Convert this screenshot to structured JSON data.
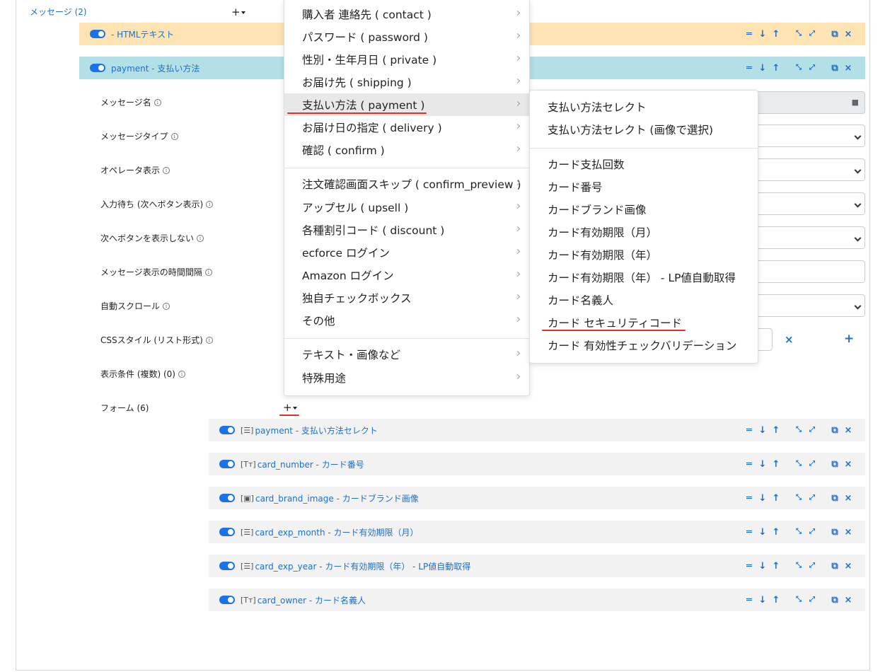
{
  "message_section": {
    "label": "メッセージ (2)",
    "add_button": "+"
  },
  "messages": [
    {
      "label": "- HTMLテキスト",
      "color": "#fde4b2"
    },
    {
      "label": "payment - 支払い方法",
      "color": "#b3e0e6"
    }
  ],
  "settings": [
    {
      "label": "メッセージ名"
    },
    {
      "label": "メッセージタイプ"
    },
    {
      "label": "オペレータ表示"
    },
    {
      "label": "入力待ち (次へボタン表示)"
    },
    {
      "label": "次へボタンを表示しない"
    },
    {
      "label": "メッセージ表示の時間間隔"
    },
    {
      "label": "自動スクロール"
    },
    {
      "label": "CSSスタイル (リスト形式)"
    }
  ],
  "conditions_link": "表示条件 (複数) (0)",
  "forms_section": {
    "label": "フォーム (6)",
    "add_button": "+"
  },
  "forms": [
    {
      "type": "[☰]",
      "label": "payment - 支払い方法セレクト"
    },
    {
      "type": "[Tт]",
      "label": "card_number - カード番号"
    },
    {
      "type": "[▣]",
      "label": "card_brand_image - カードブランド画像"
    },
    {
      "type": "[☰]",
      "label": "card_exp_month - カード有効期限（月）"
    },
    {
      "type": "[☰]",
      "label": "card_exp_year - カード有効期限（年） - LP値自動取得"
    },
    {
      "type": "[Tт]",
      "label": "card_owner - カード名義人"
    }
  ],
  "row_actions": {
    "drag": "═",
    "down": "↓",
    "up": "↑",
    "collapse": "⤡",
    "expand": "⤢",
    "copy": "⧉",
    "delete": "×"
  },
  "css_field_actions": {
    "remove": "×",
    "add": "+"
  },
  "menu": {
    "items": [
      {
        "label": "購入者 連絡先 ( contact )"
      },
      {
        "label": "パスワード ( password )"
      },
      {
        "label": "性別・生年月日 ( private )"
      },
      {
        "label": "お届け先 ( shipping )"
      },
      {
        "label": "支払い方法 ( payment )"
      },
      {
        "label": "お届け日の指定 ( delivery )"
      },
      {
        "label": "確認 ( confirm )"
      },
      {
        "label": "注文確認画面スキップ ( confirm_preview )"
      },
      {
        "label": "アップセル ( upsell )"
      },
      {
        "label": "各種割引コード ( discount )"
      },
      {
        "label": "ecforce ログイン"
      },
      {
        "label": "Amazon ログイン"
      },
      {
        "label": "独自チェックボックス"
      },
      {
        "label": "その他"
      },
      {
        "label": "テキスト・画像など"
      },
      {
        "label": "特殊用途"
      }
    ]
  },
  "submenu": {
    "items": [
      {
        "label": "支払い方法セレクト"
      },
      {
        "label": "支払い方法セレクト (画像で選択)"
      },
      {
        "label": "カード支払回数"
      },
      {
        "label": "カード番号"
      },
      {
        "label": "カードブランド画像"
      },
      {
        "label": "カード有効期限（月）"
      },
      {
        "label": "カード有効期限（年）"
      },
      {
        "label": "カード有効期限（年） - LP値自動取得"
      },
      {
        "label": "カード名義人"
      },
      {
        "label": "カード セキュリティコード"
      },
      {
        "label": "カード 有効性チェックバリデーション"
      }
    ]
  },
  "colors": {
    "link": "#1f6fc5",
    "toggle": "#1a73e8",
    "highlight": "#e0302a"
  }
}
